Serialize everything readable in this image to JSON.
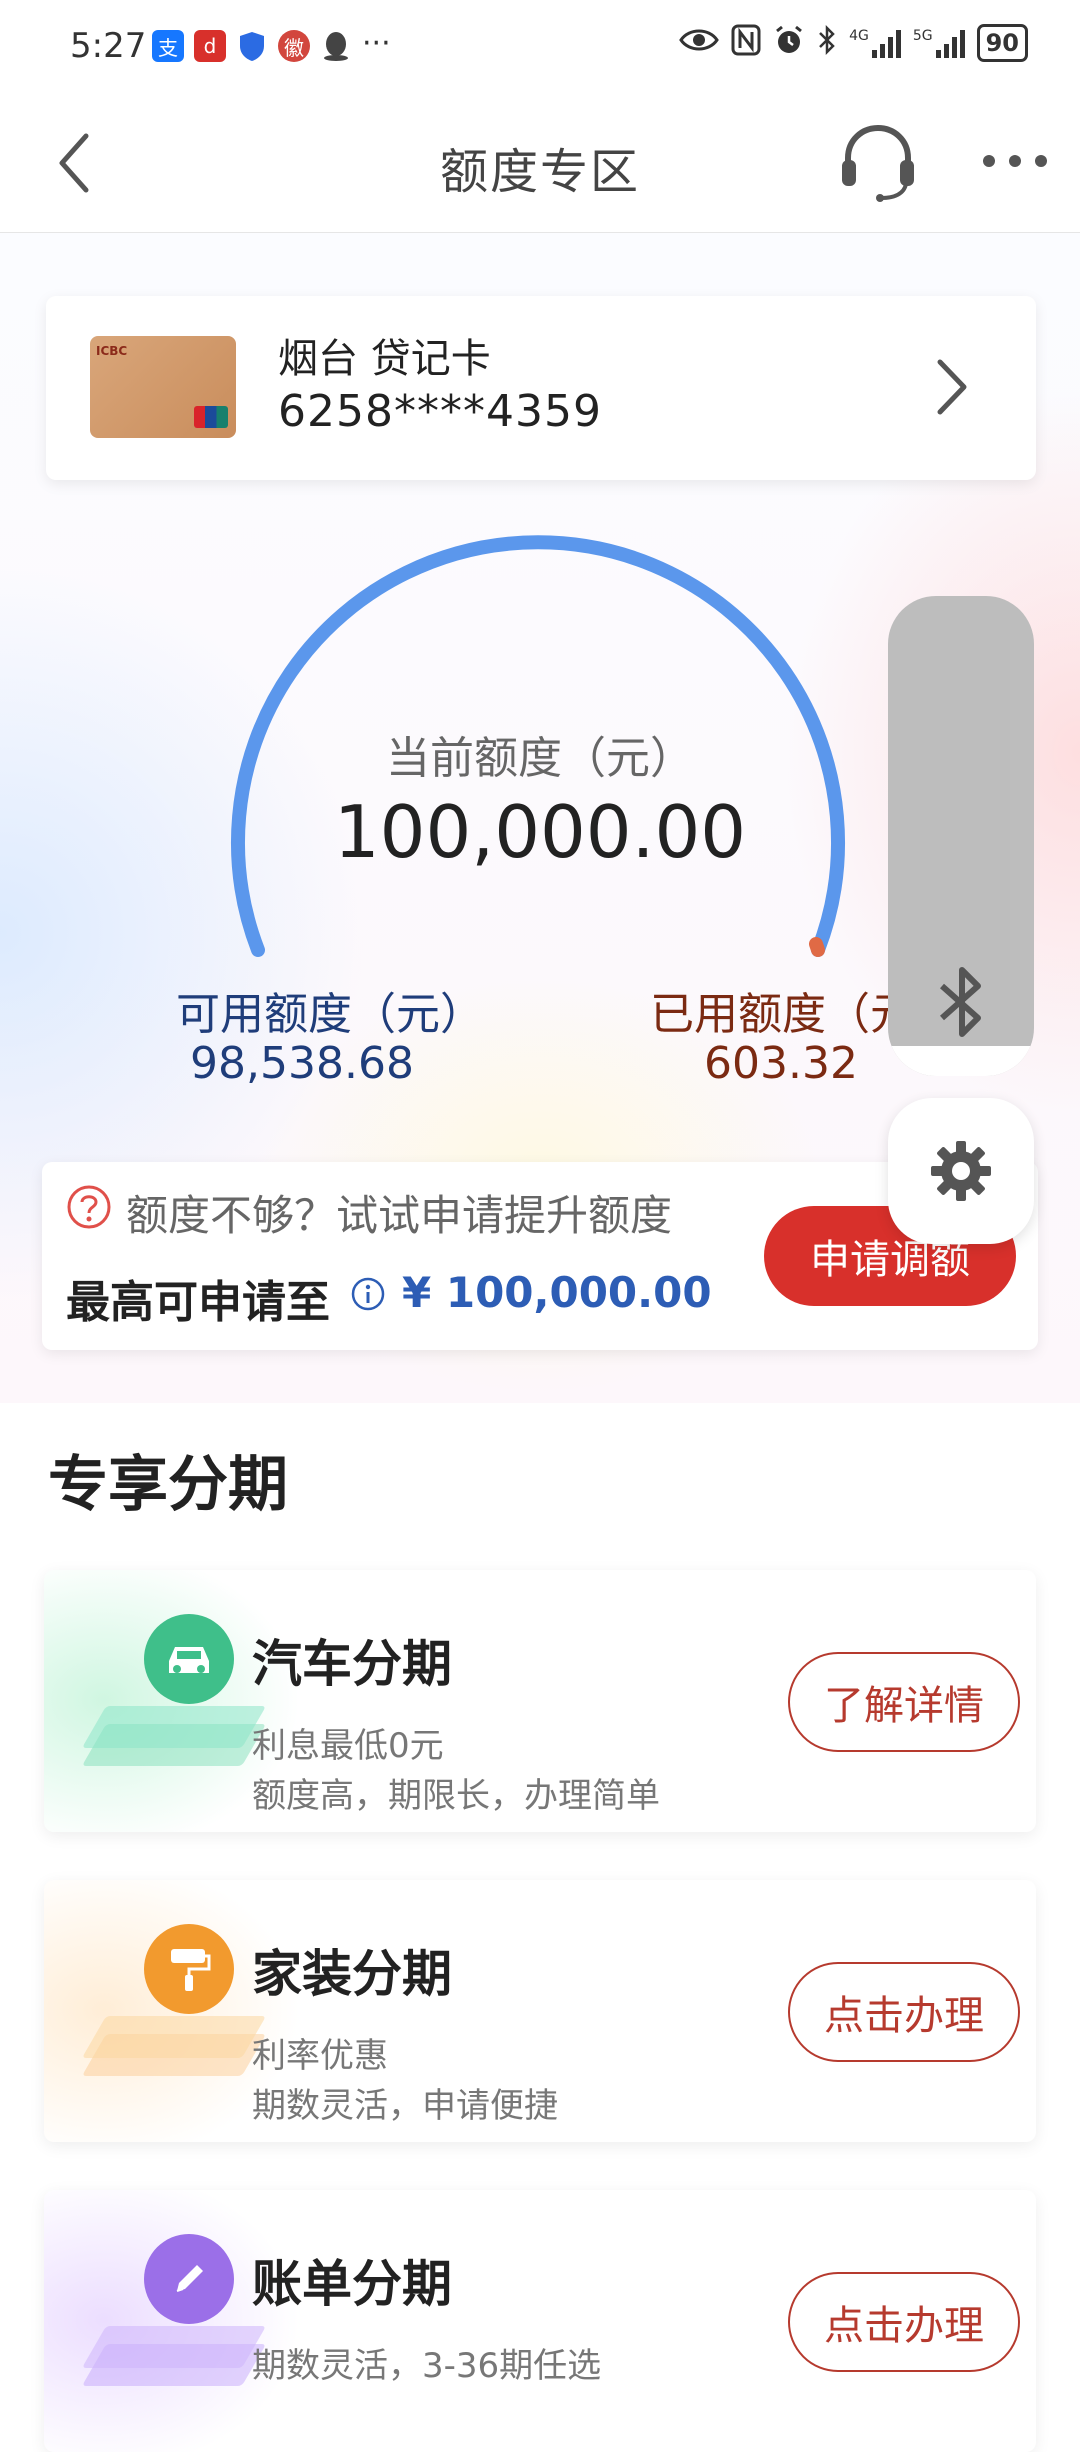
{
  "status_bar": {
    "time": "5:27",
    "more_dots": "···",
    "network_1": "4G",
    "network_2": "5G",
    "battery": "90",
    "icons": [
      "alipay-icon",
      "app-icon",
      "shield-icon",
      "app-icon",
      "qq-icon",
      "eye-icon",
      "nfc-icon",
      "alarm-icon",
      "bluetooth-icon",
      "signal-icon",
      "signal-icon",
      "battery-icon"
    ]
  },
  "header": {
    "title": "额度专区"
  },
  "card": {
    "name": "烟台 贷记卡",
    "number": "6258****4359"
  },
  "gauge": {
    "label": "当前额度（元）",
    "value": "100,000.00",
    "arc_color": "#5b97ec",
    "used_color": "#e06a45"
  },
  "available": {
    "label": "可用额度（元）",
    "value": "98,538.68"
  },
  "used": {
    "label": "已用额度（元）",
    "value": "603.32"
  },
  "raise": {
    "hint": "额度不够？试试申请提升额度",
    "max_label": "最高可申请至",
    "max_value": "¥ 100,000.00",
    "button": "申请调额"
  },
  "section": {
    "title": "专享分期"
  },
  "promos": [
    {
      "title": "汽车分期",
      "line1": "利息最低0元",
      "line2": "额度高，期限长，办理简单",
      "button": "了解详情",
      "icon": "car-icon",
      "color": "#3fbf8a"
    },
    {
      "title": "家装分期",
      "line1": "利率优惠",
      "line2": "期数灵活，申请便捷",
      "button": "点击办理",
      "icon": "paint-roller-icon",
      "color": "#f29a2e"
    },
    {
      "title": "账单分期",
      "line1": "期数灵活，3-36期任选",
      "line2": "",
      "button": "点击办理",
      "icon": "pen-icon",
      "color": "#9b6fe8"
    }
  ]
}
